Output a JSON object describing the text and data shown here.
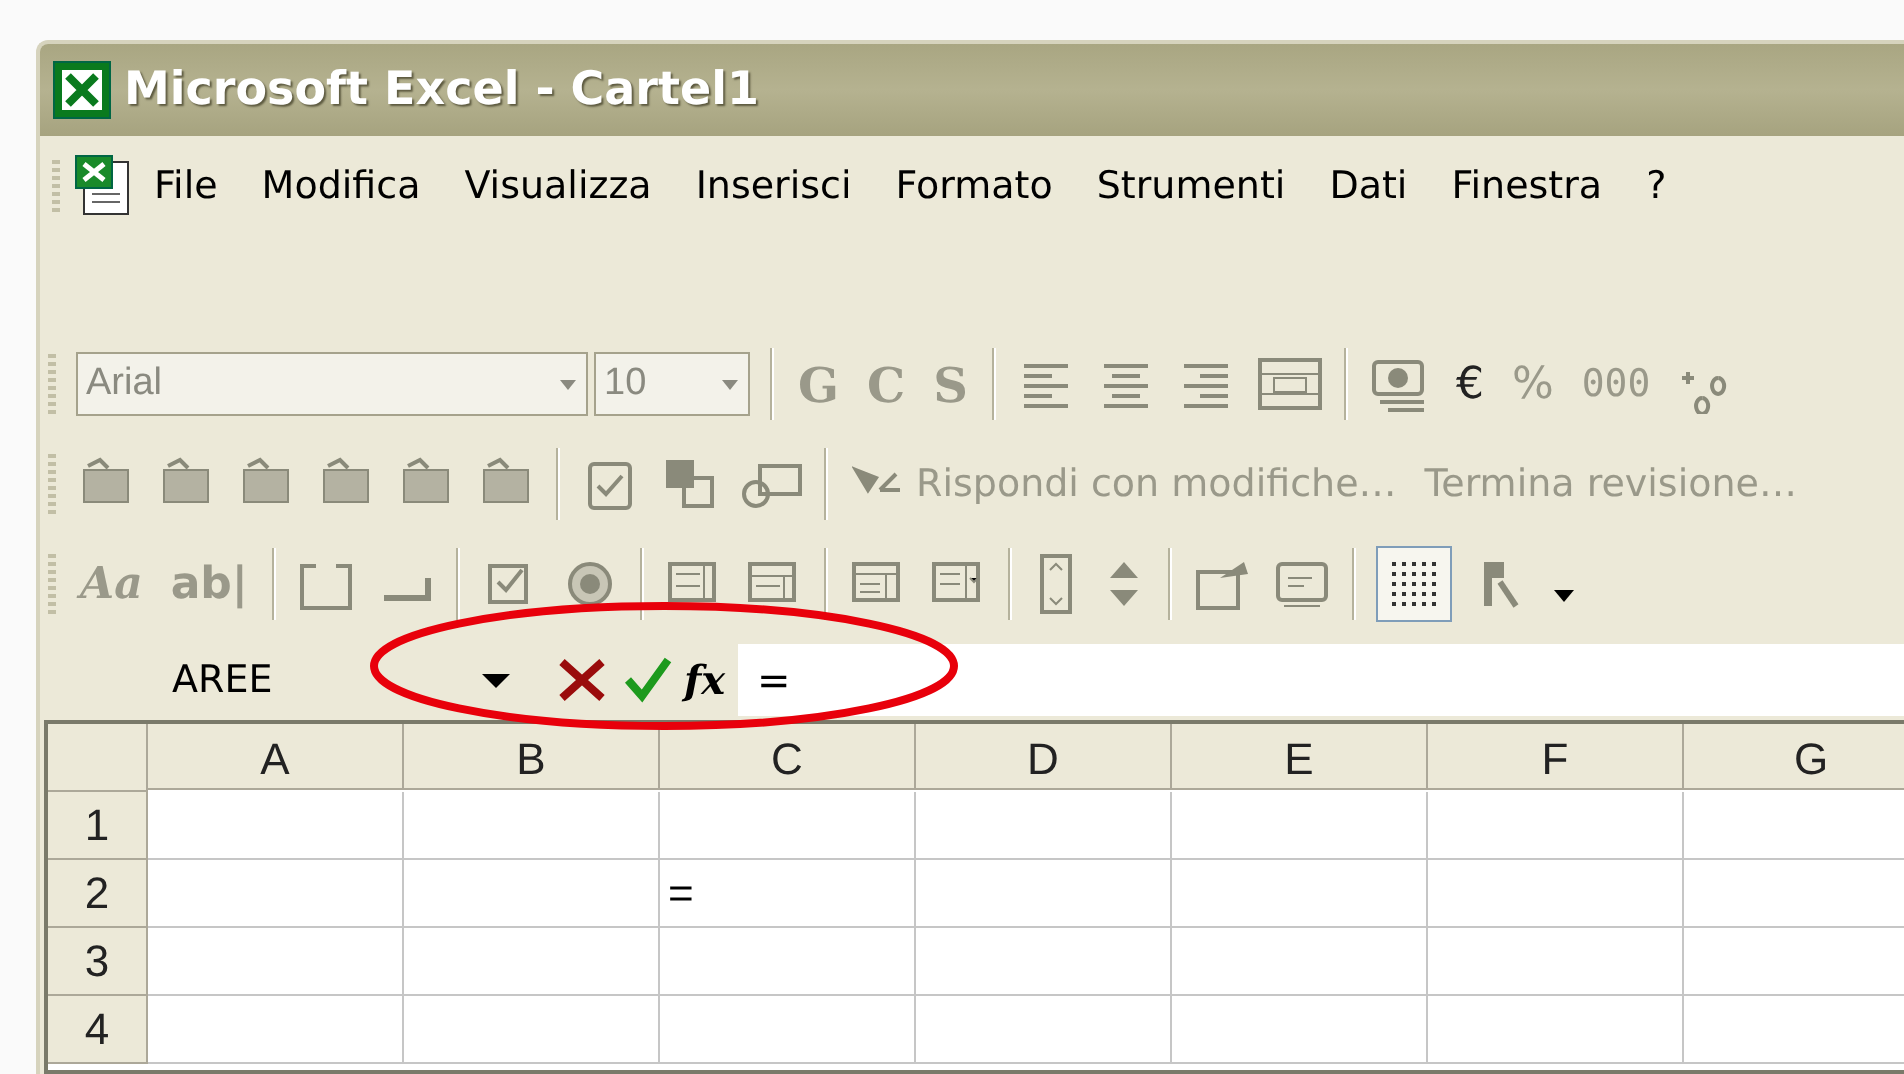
{
  "window": {
    "title": "Microsoft Excel - Cartel1"
  },
  "menu": [
    {
      "label": "File"
    },
    {
      "label": "Modifica"
    },
    {
      "label": "Visualizza"
    },
    {
      "label": "Inserisci"
    },
    {
      "label": "Formato"
    },
    {
      "label": "Strumenti"
    },
    {
      "label": "Dati"
    },
    {
      "label": "Finestra"
    },
    {
      "label": "?"
    }
  ],
  "formatting_toolbar": {
    "font": "Arial",
    "size": "10",
    "style_buttons": [
      {
        "label": "G",
        "disabled": true
      },
      {
        "label": "C",
        "disabled": true
      },
      {
        "label": "S",
        "disabled": true
      }
    ],
    "number_buttons": [
      {
        "label": "€",
        "disabled": false
      },
      {
        "label": "%",
        "disabled": true
      },
      {
        "label": "000",
        "disabled": true
      }
    ]
  },
  "reviewing_toolbar": {
    "buttons": [
      {
        "label": "Rispondi con modifiche…",
        "disabled": true
      },
      {
        "label": "Termina revisione…",
        "disabled": true
      }
    ]
  },
  "forms_toolbar": {
    "text_buttons": [
      {
        "label": "Aa"
      },
      {
        "label": "ab|"
      }
    ],
    "grid_toggle": {
      "on": true
    }
  },
  "formula_bar": {
    "name_box": "AREE",
    "function_label": "fx",
    "formula": "="
  },
  "sheet": {
    "columns": [
      "A",
      "B",
      "C",
      "D",
      "E",
      "F",
      "G"
    ],
    "rows": [
      {
        "label": "1",
        "cells": [
          null,
          null,
          null,
          null,
          null,
          null,
          null
        ]
      },
      {
        "label": "2",
        "cells": [
          null,
          null,
          "=",
          null,
          null,
          null,
          null
        ]
      },
      {
        "label": "3",
        "cells": [
          null,
          null,
          null,
          null,
          null,
          null,
          null
        ]
      },
      {
        "label": "4",
        "cells": [
          null,
          null,
          null,
          null,
          null,
          null,
          null
        ]
      }
    ]
  }
}
